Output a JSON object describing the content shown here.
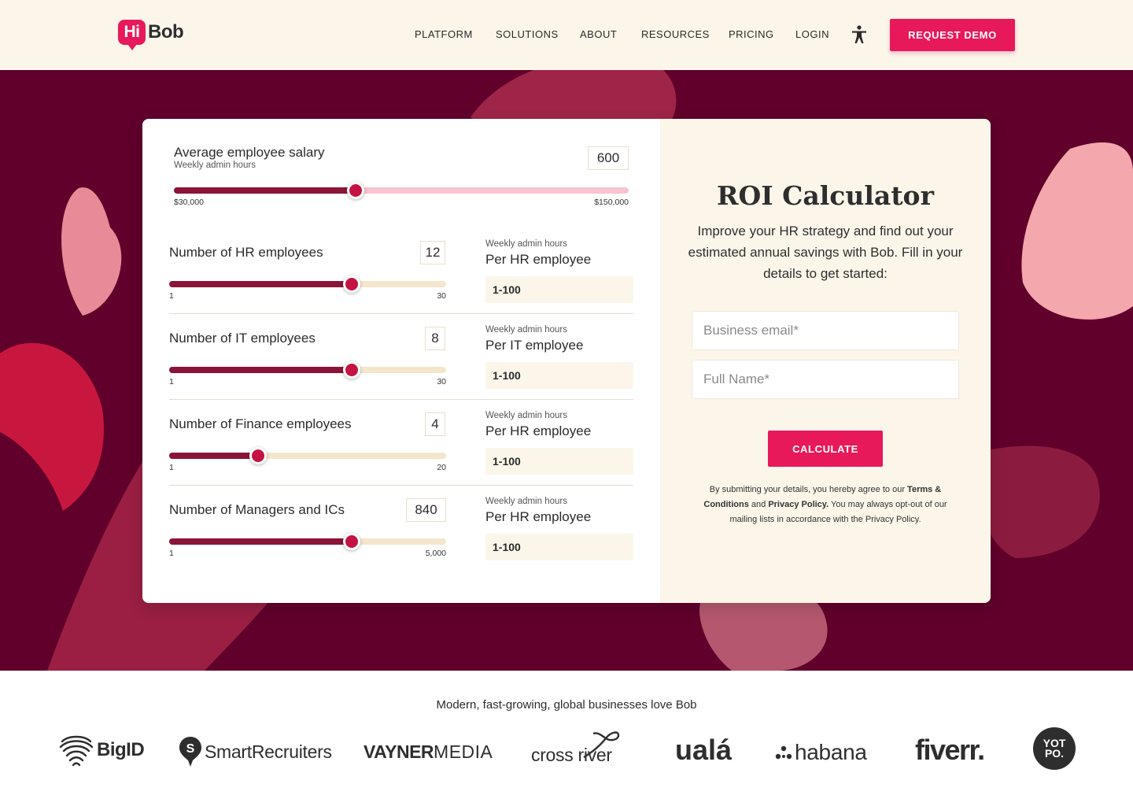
{
  "header": {
    "logo_hi": "Hi",
    "logo_bob": "Bob",
    "nav": [
      "PLATFORM",
      "SOLUTIONS",
      "ABOUT",
      "RESOURCES",
      "PRICING",
      "LOGIN"
    ],
    "demo_button": "REQUEST DEMO"
  },
  "calculator": {
    "salary": {
      "label": "Average employee salary",
      "sublabel": "Weekly admin hours",
      "value": "600",
      "min_label": "$30,000",
      "max_label": "$150,000",
      "fill_fraction": 0.4
    },
    "rows": [
      {
        "label": "Number of HR employees",
        "value": "12",
        "min": "1",
        "max": "30",
        "fill_fraction": 0.66,
        "weekly": "Weekly admin hours",
        "per": "Per HR employee",
        "range": "1-100"
      },
      {
        "label": "Number of IT employees",
        "value": "8",
        "min": "1",
        "max": "30",
        "fill_fraction": 0.66,
        "weekly": "Weekly admin hours",
        "per": "Per IT employee",
        "range": "1-100"
      },
      {
        "label": "Number of Finance employees",
        "value": "4",
        "min": "1",
        "max": "20",
        "fill_fraction": 0.32,
        "weekly": "Weekly admin hours",
        "per": "Per HR employee",
        "range": "1-100"
      },
      {
        "label": "Number of Managers and ICs",
        "value": "840",
        "min": "1",
        "max": "5,000",
        "fill_fraction": 0.66,
        "weekly": "Weekly admin hours",
        "per": "Per HR employee",
        "range": "1-100"
      }
    ]
  },
  "roi": {
    "title": "ROI Calculator",
    "description": "Improve your HR strategy and find out your estimated annual savings with Bob. Fill in your details to get started:",
    "email_placeholder": "Business email*",
    "name_placeholder": "Full Name*",
    "calculate": "CALCULATE",
    "legal_1": "By submitting your details, you hereby agree to our",
    "terms": "Terms & Conditions",
    "and": "and",
    "privacy": "Privacy Policy.",
    "legal_2": "You may always opt-out of our mailing lists in accordance with the Privacy Policy."
  },
  "customers": {
    "title": "Modern, fast-growing, global businesses love Bob",
    "logos": [
      "BigID",
      "SmartRecruiters",
      "VAYNER",
      "MEDIA",
      "cross river",
      "ualá",
      "habana",
      "fiverr.",
      "YOT",
      "PO."
    ]
  },
  "colors": {
    "brand": "#e8195b",
    "hero_bg": "#60002b",
    "slider_fill": "#8a1538",
    "cream": "#fcf6ea"
  }
}
